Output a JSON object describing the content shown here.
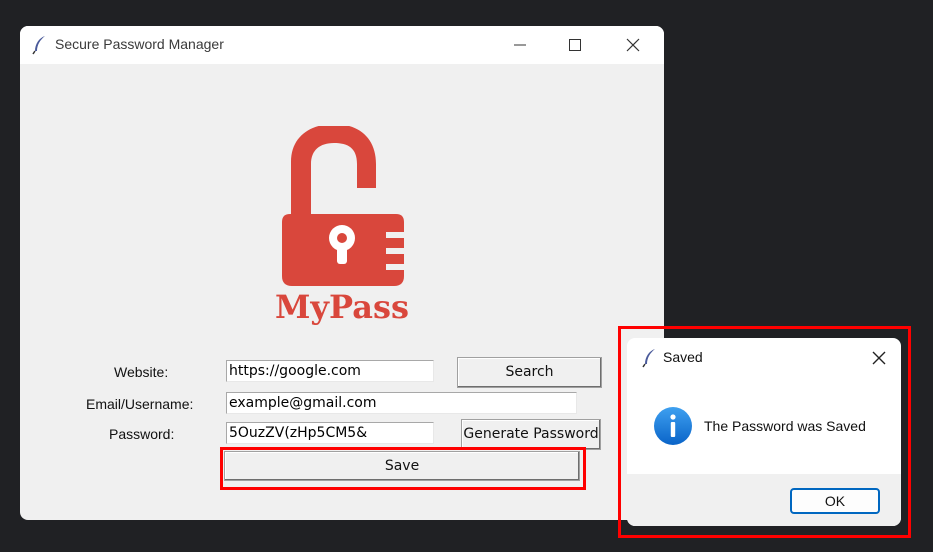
{
  "main_window": {
    "title": "Secure Password Manager",
    "logo_text": "MyPass",
    "form": {
      "website_label": "Website:",
      "website_value": "https://google.com",
      "email_label": "Email/Username:",
      "email_value": "example@gmail.com",
      "password_label": "Password:",
      "password_value": "5OuzZV(zHp5CM5&",
      "search_button": "Search",
      "generate_button": "Generate Password",
      "save_button": "Save"
    }
  },
  "dialog": {
    "title": "Saved",
    "message": "The Password was Saved",
    "ok_button": "OK"
  },
  "colors": {
    "logo_red": "#d9473c",
    "highlight": "#ff0000",
    "info_blue": "#1a73e8",
    "dialog_focus": "#0067c0"
  }
}
